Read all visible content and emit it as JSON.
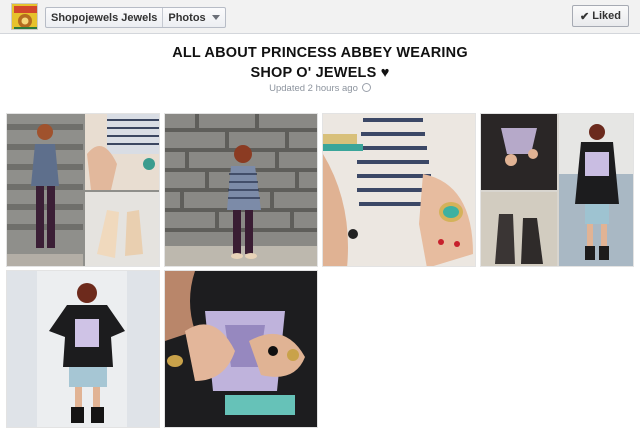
{
  "header": {
    "page_name": "Shopojewels Jewels",
    "section": "Photos",
    "liked_label": "Liked"
  },
  "album": {
    "title_line1": "ALL ABOUT PRINCESS ABBEY WEARING",
    "title_line2": "SHOP O' JEWELS ♥",
    "updated": "Updated 2 hours ago"
  },
  "photos": [
    {
      "icon": "outfit-collage-photo"
    },
    {
      "icon": "brick-wall-outfit-photo"
    },
    {
      "icon": "jewelry-closeup-photo"
    },
    {
      "icon": "black-top-collage-photo"
    },
    {
      "icon": "white-wall-outfit-photo"
    },
    {
      "icon": "rings-closeup-photo"
    }
  ],
  "colors": {
    "header_bg": "#f2f2f2",
    "border": "#d3d6db",
    "text_muted": "#8d949e"
  }
}
